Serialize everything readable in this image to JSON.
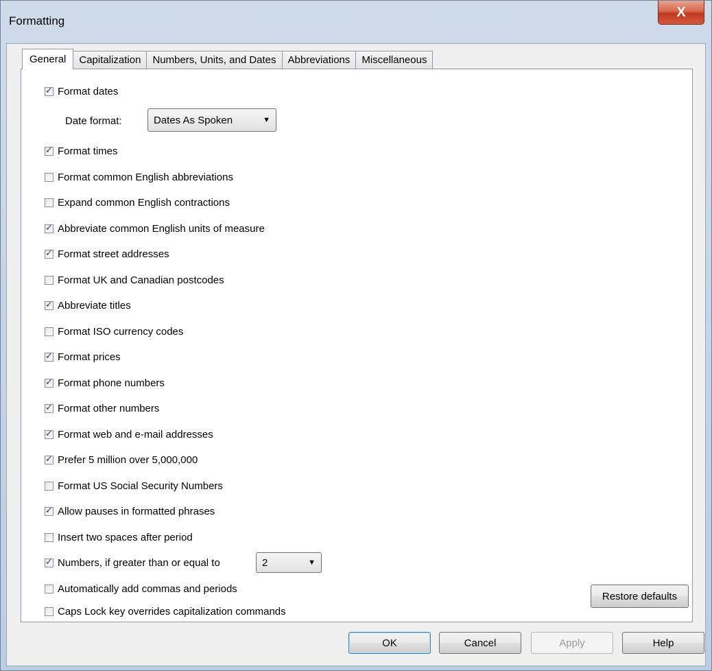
{
  "window": {
    "title": "Formatting",
    "close_glyph": "X"
  },
  "tabs": [
    {
      "label": "General"
    },
    {
      "label": "Capitalization"
    },
    {
      "label": "Numbers, Units, and Dates"
    },
    {
      "label": "Abbreviations"
    },
    {
      "label": "Miscellaneous"
    }
  ],
  "date_format": {
    "label": "Date format:",
    "selected": "Dates As Spoken"
  },
  "numbers_threshold": {
    "selected": "2"
  },
  "options": [
    {
      "label": "Format dates",
      "checked": true
    },
    {
      "label": "Format times",
      "checked": true
    },
    {
      "label": "Format common English abbreviations",
      "checked": false
    },
    {
      "label": "Expand common English contractions",
      "checked": false
    },
    {
      "label": "Abbreviate common English units of measure",
      "checked": true
    },
    {
      "label": "Format street addresses",
      "checked": true
    },
    {
      "label": "Format UK and Canadian postcodes",
      "checked": false
    },
    {
      "label": "Abbreviate titles",
      "checked": true
    },
    {
      "label": "Format ISO currency codes",
      "checked": false
    },
    {
      "label": "Format prices",
      "checked": true
    },
    {
      "label": "Format phone numbers",
      "checked": true
    },
    {
      "label": "Format other numbers",
      "checked": true
    },
    {
      "label": "Format web and e-mail addresses",
      "checked": true
    },
    {
      "label": "Prefer 5 million over 5,000,000",
      "checked": true
    },
    {
      "label": "Format US Social Security Numbers",
      "checked": false
    },
    {
      "label": "Allow pauses in formatted phrases",
      "checked": true
    },
    {
      "label": "Insert two spaces after period",
      "checked": false
    },
    {
      "label": "Numbers, if greater than or equal to",
      "checked": true
    },
    {
      "label": "Automatically add commas and periods",
      "checked": false
    },
    {
      "label": "Caps Lock key overrides capitalization commands",
      "checked": false
    }
  ],
  "buttons": {
    "restore": "Restore defaults",
    "ok": "OK",
    "cancel": "Cancel",
    "apply": "Apply",
    "help": "Help"
  }
}
